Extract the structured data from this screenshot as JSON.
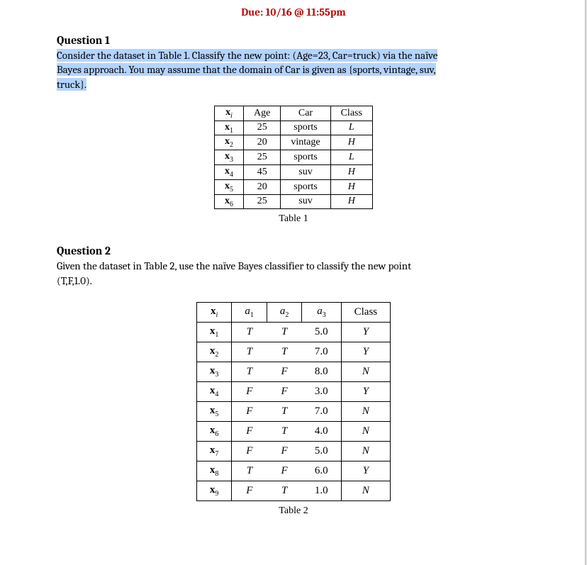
{
  "due": "Due: 10/16 @ 11:55pm",
  "q1": {
    "title": "Question 1",
    "body_hl_1": "Consider the dataset in Table 1. Classify the new point: (Age=23, Car=truck) via the naïve",
    "body_hl_2": "Bayes approach. You may assume that the domain of Car is given as {sports, vintage, suv,",
    "body_hl_3": "truck}.",
    "table": {
      "headers": [
        "xᵢ",
        "Age",
        "Car",
        "Class"
      ],
      "rows": [
        [
          "x₁",
          "25",
          "sports",
          "L"
        ],
        [
          "x₂",
          "20",
          "vintage",
          "H"
        ],
        [
          "x₃",
          "25",
          "sports",
          "L"
        ],
        [
          "x₄",
          "45",
          "suv",
          "H"
        ],
        [
          "x₅",
          "20",
          "sports",
          "H"
        ],
        [
          "x₆",
          "25",
          "suv",
          "H"
        ]
      ],
      "caption": "Table 1"
    }
  },
  "q2": {
    "title": "Question 2",
    "body_line1": "Given the dataset in Table 2, use the naïve Bayes classifier to classify the new point",
    "body_line2": "(T,F,1.0).",
    "table": {
      "headers": [
        "xᵢ",
        "a₁",
        "a₂",
        "a₃",
        "Class"
      ],
      "rows": [
        [
          "x₁",
          "T",
          "T",
          "5.0",
          "Y"
        ],
        [
          "x₂",
          "T",
          "T",
          "7.0",
          "Y"
        ],
        [
          "x₃",
          "T",
          "F",
          "8.0",
          "N"
        ],
        [
          "x₄",
          "F",
          "F",
          "3.0",
          "Y"
        ],
        [
          "x₅",
          "F",
          "T",
          "7.0",
          "N"
        ],
        [
          "x₆",
          "F",
          "T",
          "4.0",
          "N"
        ],
        [
          "x₇",
          "F",
          "F",
          "5.0",
          "N"
        ],
        [
          "x₈",
          "T",
          "F",
          "6.0",
          "Y"
        ],
        [
          "x₉",
          "F",
          "T",
          "1.0",
          "N"
        ]
      ],
      "caption": "Table 2"
    }
  }
}
